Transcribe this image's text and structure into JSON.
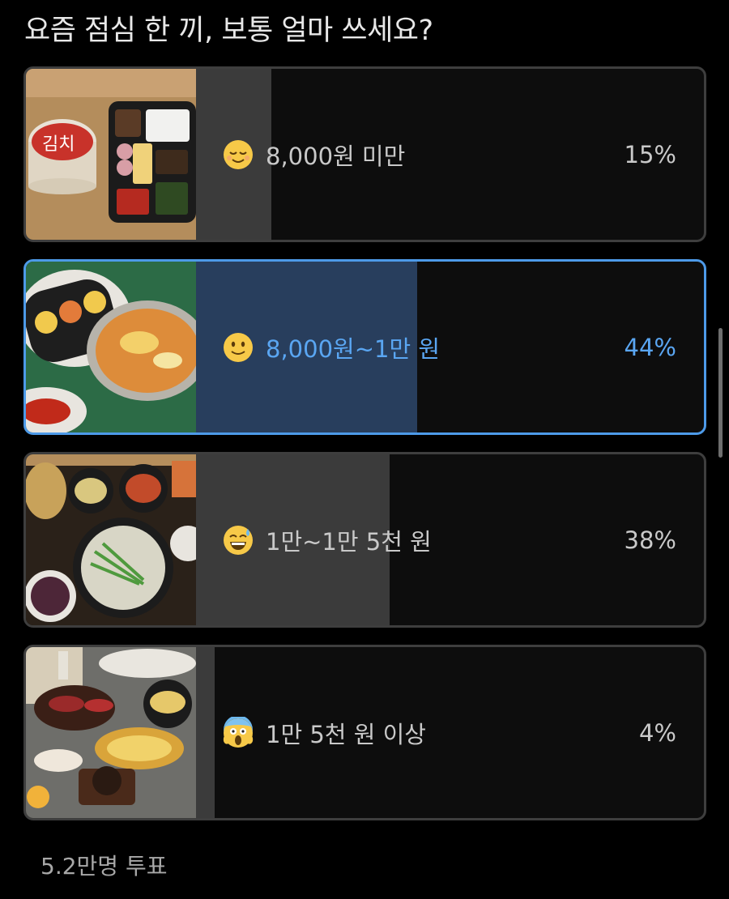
{
  "poll": {
    "question": "요즘 점심 한 끼, 보통 얼마 쓰세요?",
    "total_votes": "5.2만명 투표",
    "options": [
      {
        "emoji": "relieved-face-icon",
        "label": "8,000원 미만",
        "percent_label": "15%",
        "percent": 15,
        "selected": false,
        "photo": "cup-noodle-and-lunchbox-photo"
      },
      {
        "emoji": "slightly-smiling-face-icon",
        "label": "8,000원~1만 원",
        "percent_label": "44%",
        "percent": 44,
        "selected": true,
        "photo": "kimbap-and-ramen-photo"
      },
      {
        "emoji": "grinning-sweat-face-icon",
        "label": "1만~1만 5천 원",
        "percent_label": "38%",
        "percent": 38,
        "selected": false,
        "photo": "korean-set-meal-photo"
      },
      {
        "emoji": "screaming-face-icon",
        "label": "1만 5천 원 이상",
        "percent_label": "4%",
        "percent": 4,
        "selected": false,
        "photo": "restaurant-feast-photo"
      }
    ]
  },
  "colors": {
    "background": "#000000",
    "bar_fill": "#3b3b3b",
    "selected_fill": "#283e5d",
    "selected_accent": "#4d9ae8"
  }
}
